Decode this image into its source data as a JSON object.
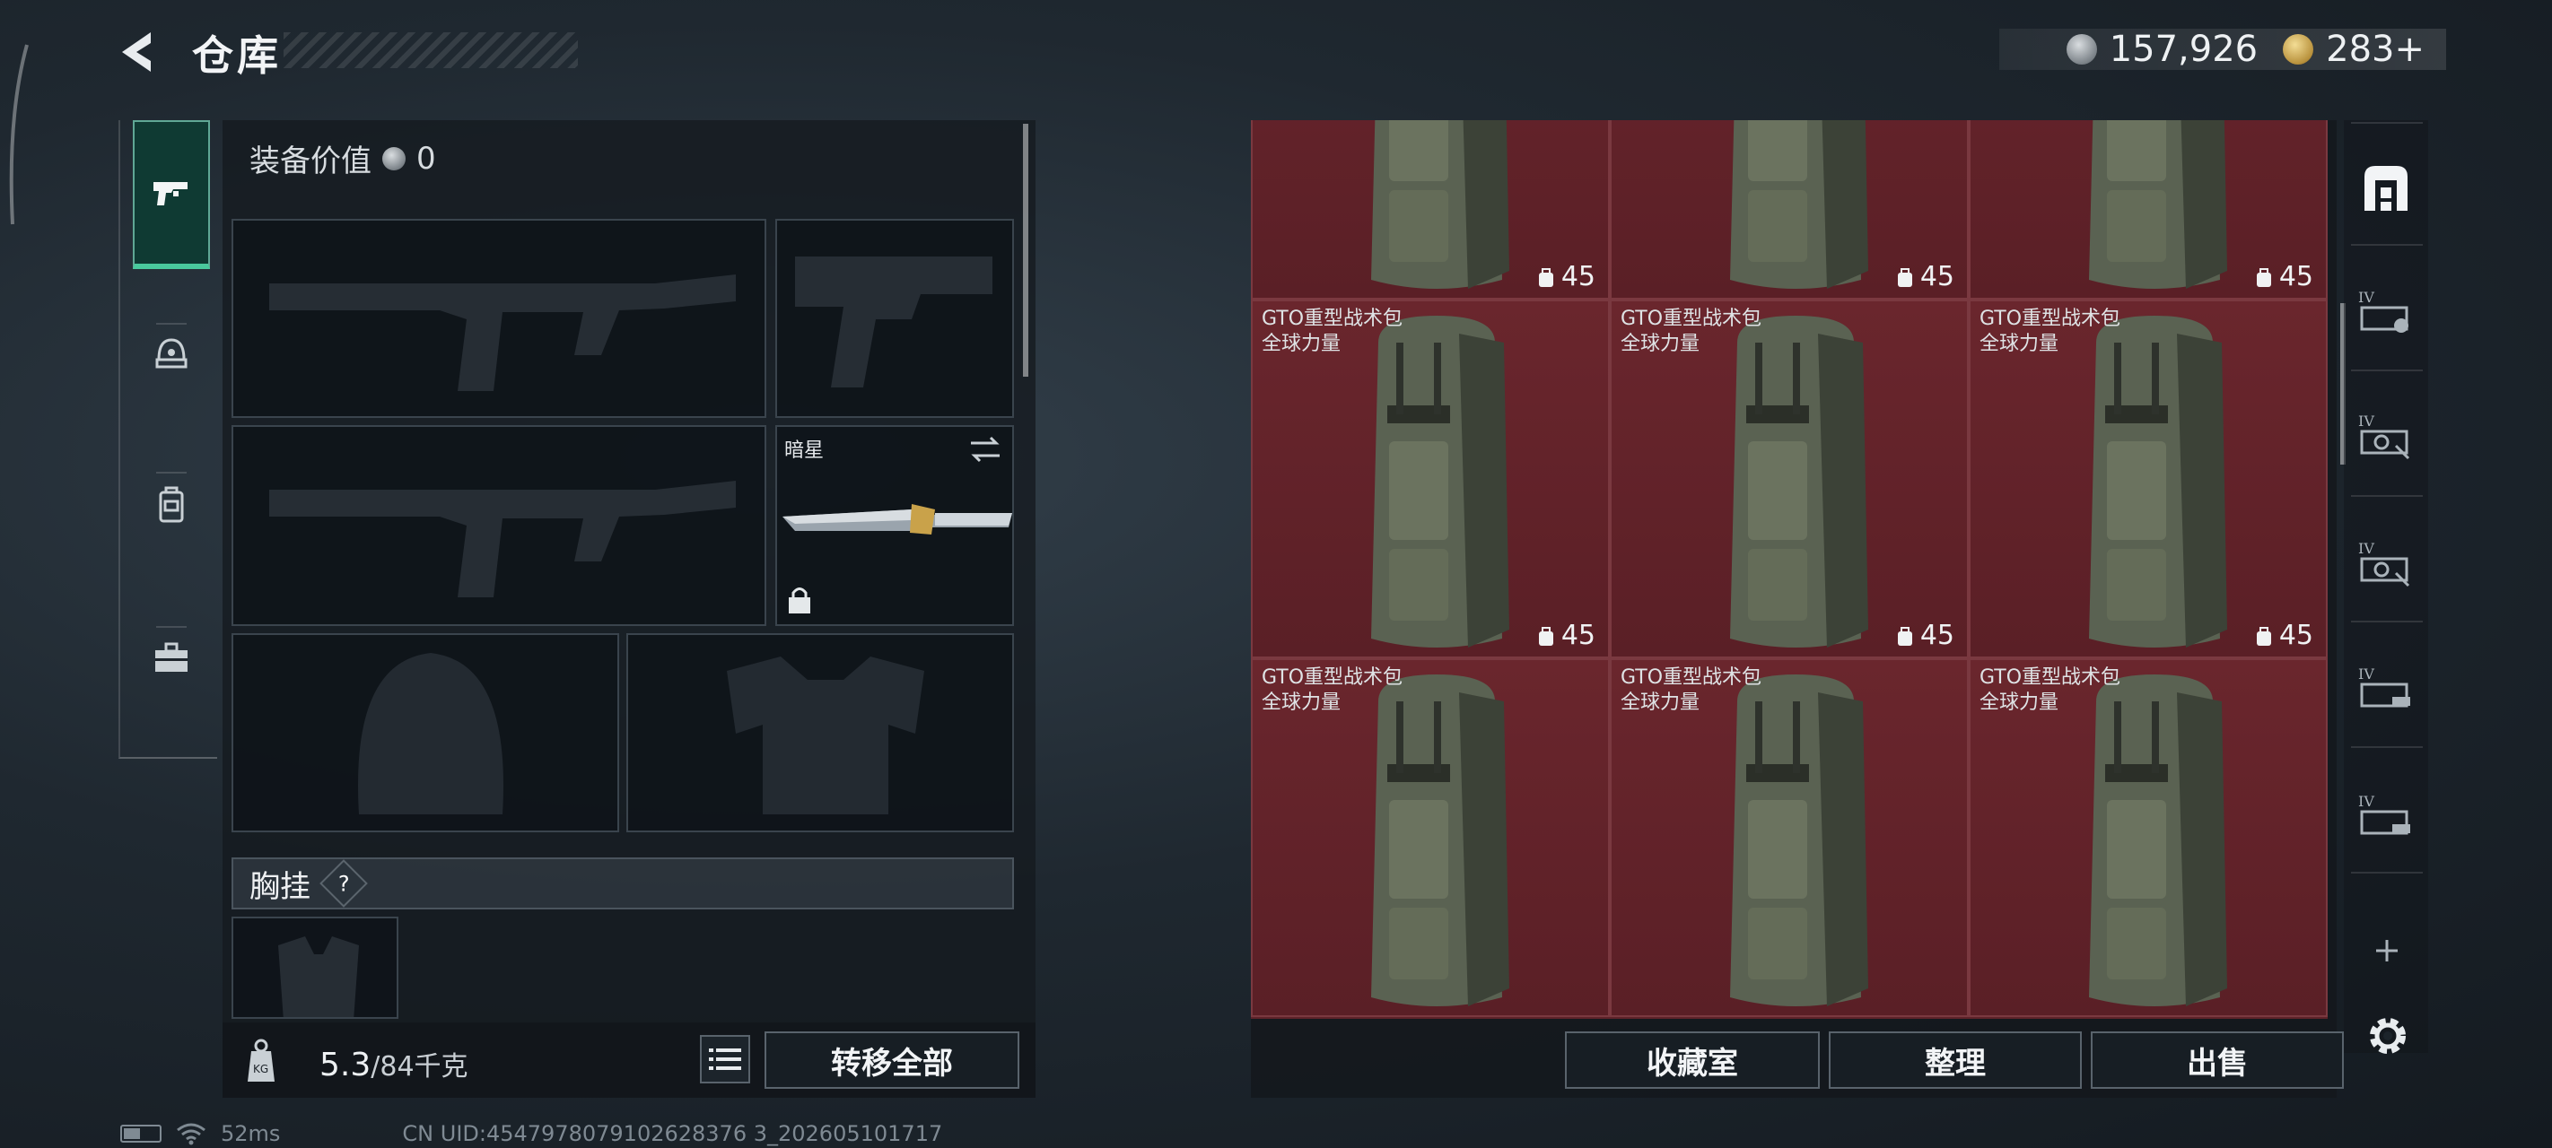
{
  "header": {
    "title": "仓库",
    "currency": [
      {
        "icon": "silver-coin-icon",
        "value": "157,926"
      },
      {
        "icon": "gold-coin-icon",
        "value": "283+"
      }
    ]
  },
  "left_tabs": [
    {
      "name": "weapons",
      "icon": "pistol-icon",
      "active": true
    },
    {
      "name": "armor",
      "icon": "helmet-icon",
      "active": false
    },
    {
      "name": "backpack",
      "icon": "backpack-icon",
      "active": false
    },
    {
      "name": "toolbox",
      "icon": "toolbox-icon",
      "active": false
    }
  ],
  "equipment": {
    "value_label": "装备价值",
    "value": "0",
    "melee_label": "暗星",
    "chest_rig_label": "胸挂",
    "chest_rig_help": "?"
  },
  "bottom": {
    "weight_value": "5.3",
    "weight_capacity": "/84千克",
    "transfer_all": "转移全部"
  },
  "status": {
    "ping": "52ms",
    "uid": "CN UID:4547978079102628376 3_202605101717"
  },
  "grid_items": [
    {
      "name": "",
      "brand": "",
      "count": "45"
    },
    {
      "name": "",
      "brand": "",
      "count": "45"
    },
    {
      "name": "",
      "brand": "",
      "count": "45"
    },
    {
      "name": "GTO重型战术包",
      "brand": "全球力量",
      "count": "45"
    },
    {
      "name": "GTO重型战术包",
      "brand": "全球力量",
      "count": "45"
    },
    {
      "name": "GTO重型战术包",
      "brand": "全球力量",
      "count": "45"
    },
    {
      "name": "GTO重型战术包",
      "brand": "全球力量",
      "count": ""
    },
    {
      "name": "GTO重型战术包",
      "brand": "全球力量",
      "count": ""
    },
    {
      "name": "GTO重型战术包",
      "brand": "全球力量",
      "count": ""
    }
  ],
  "grid_actions": {
    "collection": "收藏室",
    "organize": "整理",
    "sell": "出售"
  },
  "right_rail": {
    "tier_label": "IV"
  },
  "colors": {
    "accent_green": "#49c99d",
    "cell_red": "#5d2229"
  }
}
